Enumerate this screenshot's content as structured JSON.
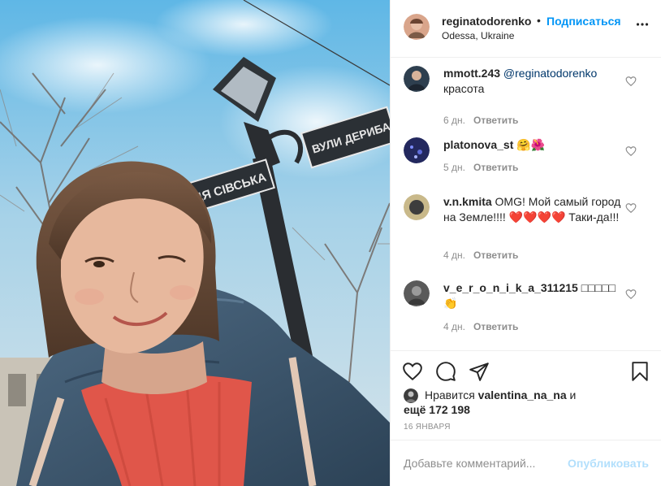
{
  "header": {
    "username": "reginatodorenko",
    "separator": "•",
    "follow_label": "Подписаться",
    "location": "Odessa, Ukraine",
    "more_icon": "more-horizontal-icon"
  },
  "photo": {
    "street_sign_left": "ЛИЦЯ СІВСЬКА",
    "street_sign_right": "ВУЛИ ДЕРИБАС"
  },
  "comments": [
    {
      "user": "mmott.243",
      "mention": "@reginatodorenko",
      "text": "красота",
      "age": "6 дн.",
      "reply": "Ответить"
    },
    {
      "user": "platonova_st",
      "text": "🤗🌺",
      "age": "5 дн.",
      "reply": "Ответить"
    },
    {
      "user": "v.n.kmita",
      "text": "OMG! Мой самый город на Земле!!!! ❤️❤️❤️❤️ Таки-да!!!",
      "age": "4 дн.",
      "reply": "Ответить"
    },
    {
      "user": "v_e_r_o_n_i_k_a_311215",
      "text": "□□□□□ 👏",
      "age": "4 дн.",
      "reply": "Ответить"
    }
  ],
  "actions": {
    "like_icon": "heart-icon",
    "comment_icon": "comment-icon",
    "share_icon": "share-icon",
    "save_icon": "bookmark-icon"
  },
  "likes": {
    "prefix": "Нравится",
    "user": "valentina_na_na",
    "and": "и",
    "more_prefix": "ещё",
    "count": "172 198"
  },
  "date": "16 ЯНВАРЯ",
  "add_comment": {
    "placeholder": "Добавьте комментарий...",
    "publish_label": "Опубликовать"
  },
  "colors": {
    "accent": "#0095f6",
    "publish_disabled": "#b2dffc",
    "muted": "#8e8e8e",
    "text": "#262626"
  }
}
